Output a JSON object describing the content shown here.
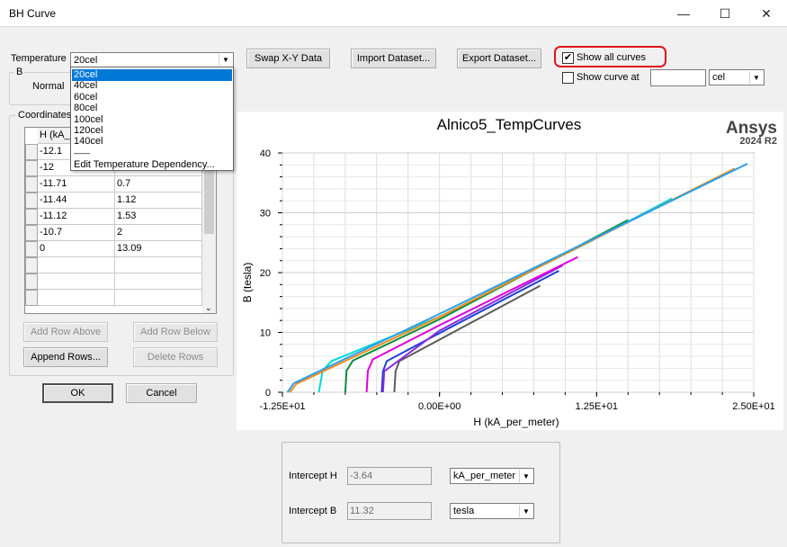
{
  "window": {
    "title": "BH Curve",
    "minimize_glyph": "—",
    "maximize_glyph": "☐",
    "close_glyph": "✕"
  },
  "temperature": {
    "label": "Temperature",
    "selected": "20cel",
    "options": [
      "20cel",
      "40cel",
      "60cel",
      "80cel",
      "100cel",
      "120cel",
      "140cel",
      "——",
      "Edit Temperature Dependency..."
    ]
  },
  "b_group": {
    "label": "B",
    "mode": "Normal"
  },
  "coords": {
    "label": "Coordinates",
    "header_h": "H (kA_p",
    "rows": [
      [
        "-12.1",
        ""
      ],
      [
        "-12",
        ""
      ],
      [
        "-11.71",
        "0.7"
      ],
      [
        "-11.44",
        "1.12"
      ],
      [
        "-11.12",
        "1.53"
      ],
      [
        "-10.7",
        "2"
      ],
      [
        "0",
        "13.09"
      ],
      [
        "",
        ""
      ],
      [
        "",
        ""
      ],
      [
        "",
        ""
      ]
    ]
  },
  "buttons": {
    "add_above": "Add Row Above",
    "add_below": "Add Row Below",
    "append": "Append Rows...",
    "delete": "Delete Rows",
    "ok": "OK",
    "cancel": "Cancel",
    "swap": "Swap X-Y Data",
    "import": "Import Dataset...",
    "export": "Export Dataset..."
  },
  "show_all_curves": {
    "label": "Show all curves",
    "checked": true,
    "highlight": "#e0141e"
  },
  "show_curve_at": {
    "label": "Show curve at",
    "checked": false,
    "value": "",
    "unit": "cel"
  },
  "chart_data": {
    "type": "line",
    "title": "Alnico5_TempCurves",
    "brand": "Ansys",
    "version": "2024 R2",
    "xlabel": "H (kA_per_meter)",
    "ylabel": "B (tesla)",
    "xlim": [
      -12.5,
      25
    ],
    "ylim": [
      0,
      40
    ],
    "x_ticks": [
      "-1.25E+01",
      "0.00E+00",
      "1.25E+01",
      "2.50E+01"
    ],
    "y_ticks": [
      "0",
      "10",
      "20",
      "30",
      "40"
    ],
    "grid": true,
    "series": [
      {
        "color": "#5a5a5a",
        "points": [
          [
            -3.6,
            0
          ],
          [
            -3.5,
            3.5
          ],
          [
            -3.2,
            5.2
          ],
          [
            0,
            8.8
          ],
          [
            8,
            17.8
          ]
        ]
      },
      {
        "color": "#1f3fd0",
        "points": [
          [
            -4.6,
            0
          ],
          [
            -4.5,
            3.5
          ],
          [
            -4.2,
            5.2
          ],
          [
            0,
            9.9
          ],
          [
            9.5,
            20.3
          ]
        ]
      },
      {
        "color": "#8a2be2",
        "points": [
          [
            -4.5,
            0
          ],
          [
            -4.4,
            3.5
          ],
          [
            0,
            10.3
          ],
          [
            9.8,
            21.2
          ]
        ]
      },
      {
        "color": "#e000d8",
        "points": [
          [
            -5.8,
            0
          ],
          [
            -5.7,
            3.6
          ],
          [
            -5.3,
            5.5
          ],
          [
            0,
            11.2
          ],
          [
            11,
            22.6
          ]
        ]
      },
      {
        "color": "#0f8a40",
        "points": [
          [
            -7.5,
            0
          ],
          [
            -7.4,
            3.6
          ],
          [
            -6.9,
            5.3
          ],
          [
            0,
            12.2
          ],
          [
            15,
            28.8
          ]
        ]
      },
      {
        "color": "#00d8d8",
        "points": [
          [
            -9.6,
            0
          ],
          [
            -9.3,
            3.6
          ],
          [
            -8.6,
            5.2
          ],
          [
            0,
            12.6
          ],
          [
            12,
            25.2
          ],
          [
            18.5,
            32.4
          ]
        ]
      },
      {
        "color": "#f08a20",
        "points": [
          [
            -11.9,
            0
          ],
          [
            -11.4,
            1.4
          ],
          [
            0,
            12.6
          ],
          [
            23.5,
            37.4
          ]
        ]
      },
      {
        "color": "#2aa0e8",
        "points": [
          [
            -12.1,
            0
          ],
          [
            -11.6,
            1.5
          ],
          [
            0,
            13.1
          ],
          [
            24.5,
            38.2
          ]
        ]
      }
    ]
  },
  "intercepts": {
    "h_label": "Intercept H",
    "h_value": "-3.64",
    "h_unit": "kA_per_meter",
    "b_label": "Intercept B",
    "b_value": "11.32",
    "b_unit": "tesla"
  }
}
